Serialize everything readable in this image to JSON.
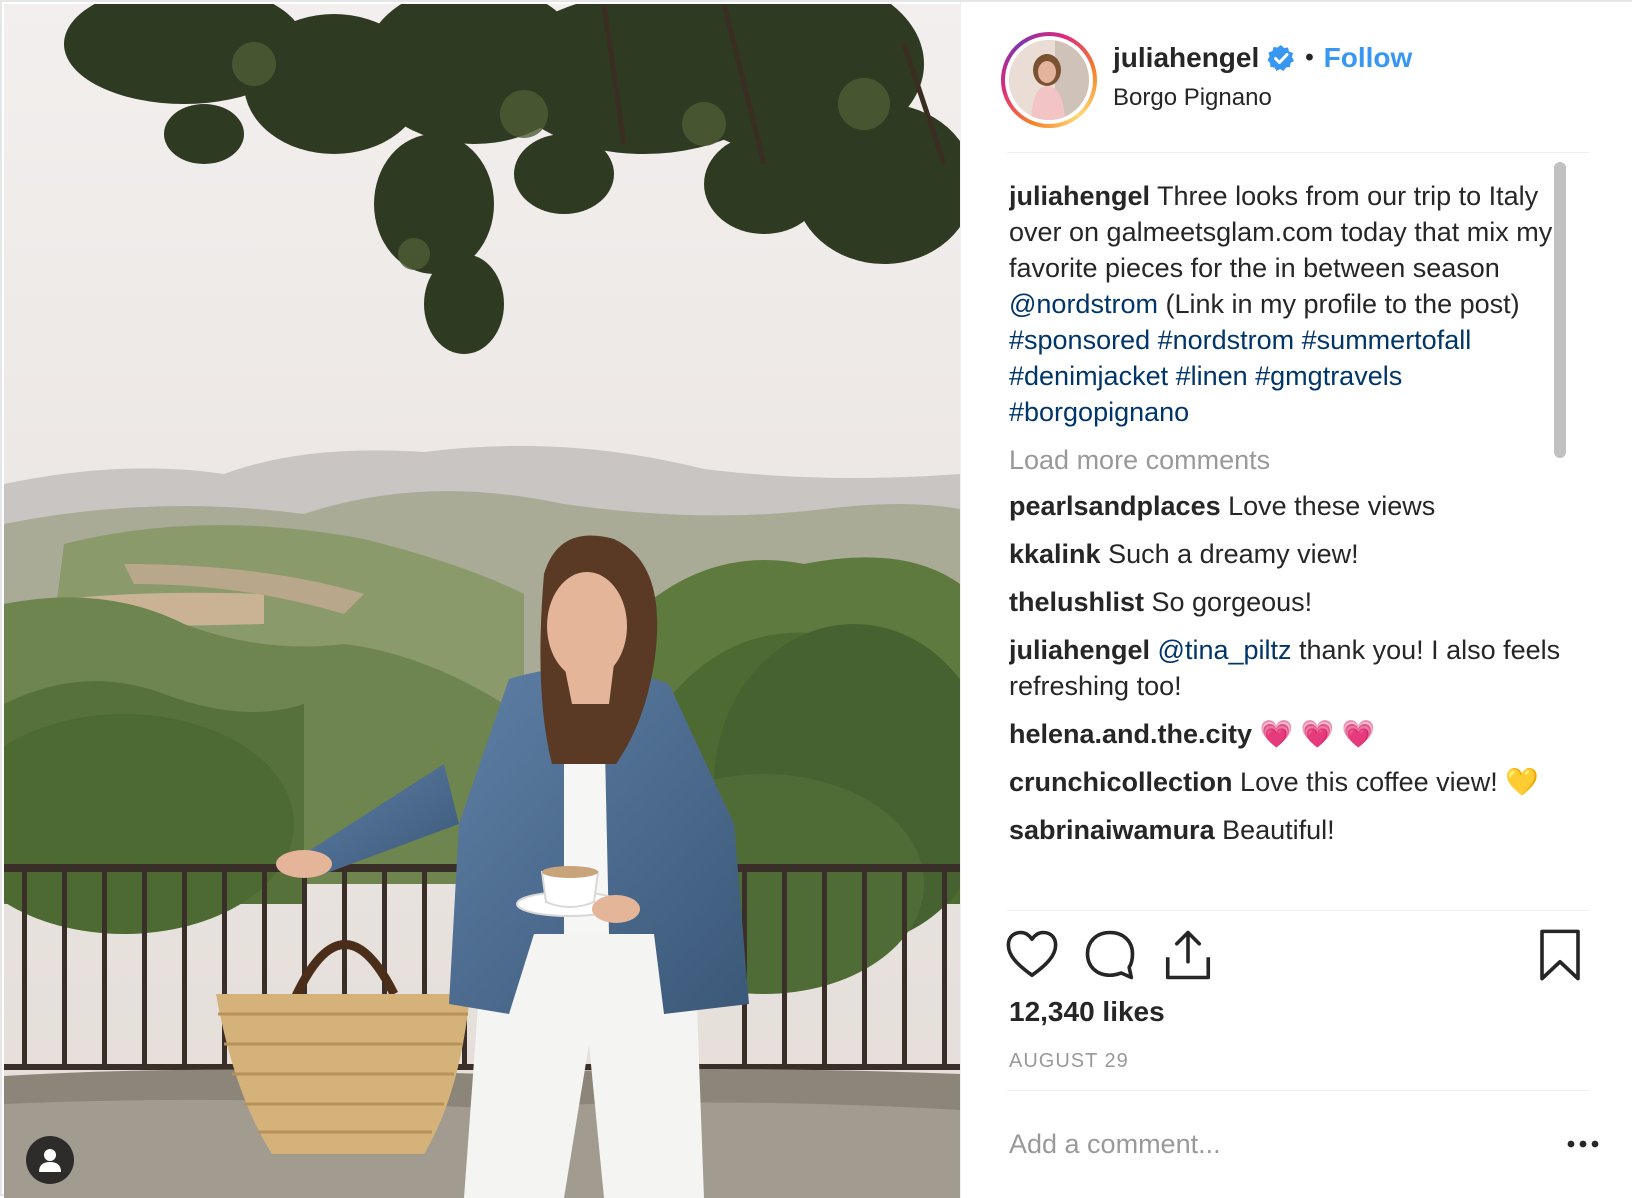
{
  "post": {
    "image_alt": "Woman in denim jacket holding a coffee cup beside a woven basket, overlooking green Tuscan hills",
    "author": {
      "username": "juliahengel",
      "verified": true,
      "follow_separator": "•",
      "follow_label": "Follow",
      "location": "Borgo Pignano"
    },
    "caption": {
      "username": "juliahengel",
      "text_1": " Three looks from our trip to Italy over on galmeetsglam.com today that mix my favorite pieces for the in between season ",
      "mention": "@nordstrom",
      "text_2": " (Link in my profile to the post) ",
      "hashtags": "#sponsored #nordstrom #summertofall #denimjacket #linen #gmgtravels #borgopignano"
    },
    "load_more_label": "Load more comments",
    "comments": [
      {
        "username": "pearlsandplaces",
        "text": " Love these views"
      },
      {
        "username": "kkalink",
        "text": " Such a dreamy view!"
      },
      {
        "username": "thelushlist",
        "text": " So gorgeous!"
      },
      {
        "username": "juliahengel",
        "mention": " @tina_piltz",
        "text": " thank you! I also feels refreshing too!"
      },
      {
        "username": "helena.and.the.city",
        "text": " 💗 💗 💗"
      },
      {
        "username": "crunchicollection",
        "text": " Love this coffee view! 💛"
      },
      {
        "username": "sabrinaiwamura",
        "text": " Beautiful!"
      }
    ],
    "likes": "12,340 likes",
    "date": "AUGUST 29",
    "comment_placeholder": "Add a comment...",
    "icons": {
      "like": "heart-icon",
      "comment": "comment-bubble-icon",
      "share": "share-icon",
      "save": "bookmark-icon",
      "more": "more-options-icon",
      "tag": "user-tag-icon"
    },
    "colors": {
      "link": "#003569",
      "follow": "#3897f0",
      "muted": "#999999",
      "text": "#262626"
    }
  }
}
